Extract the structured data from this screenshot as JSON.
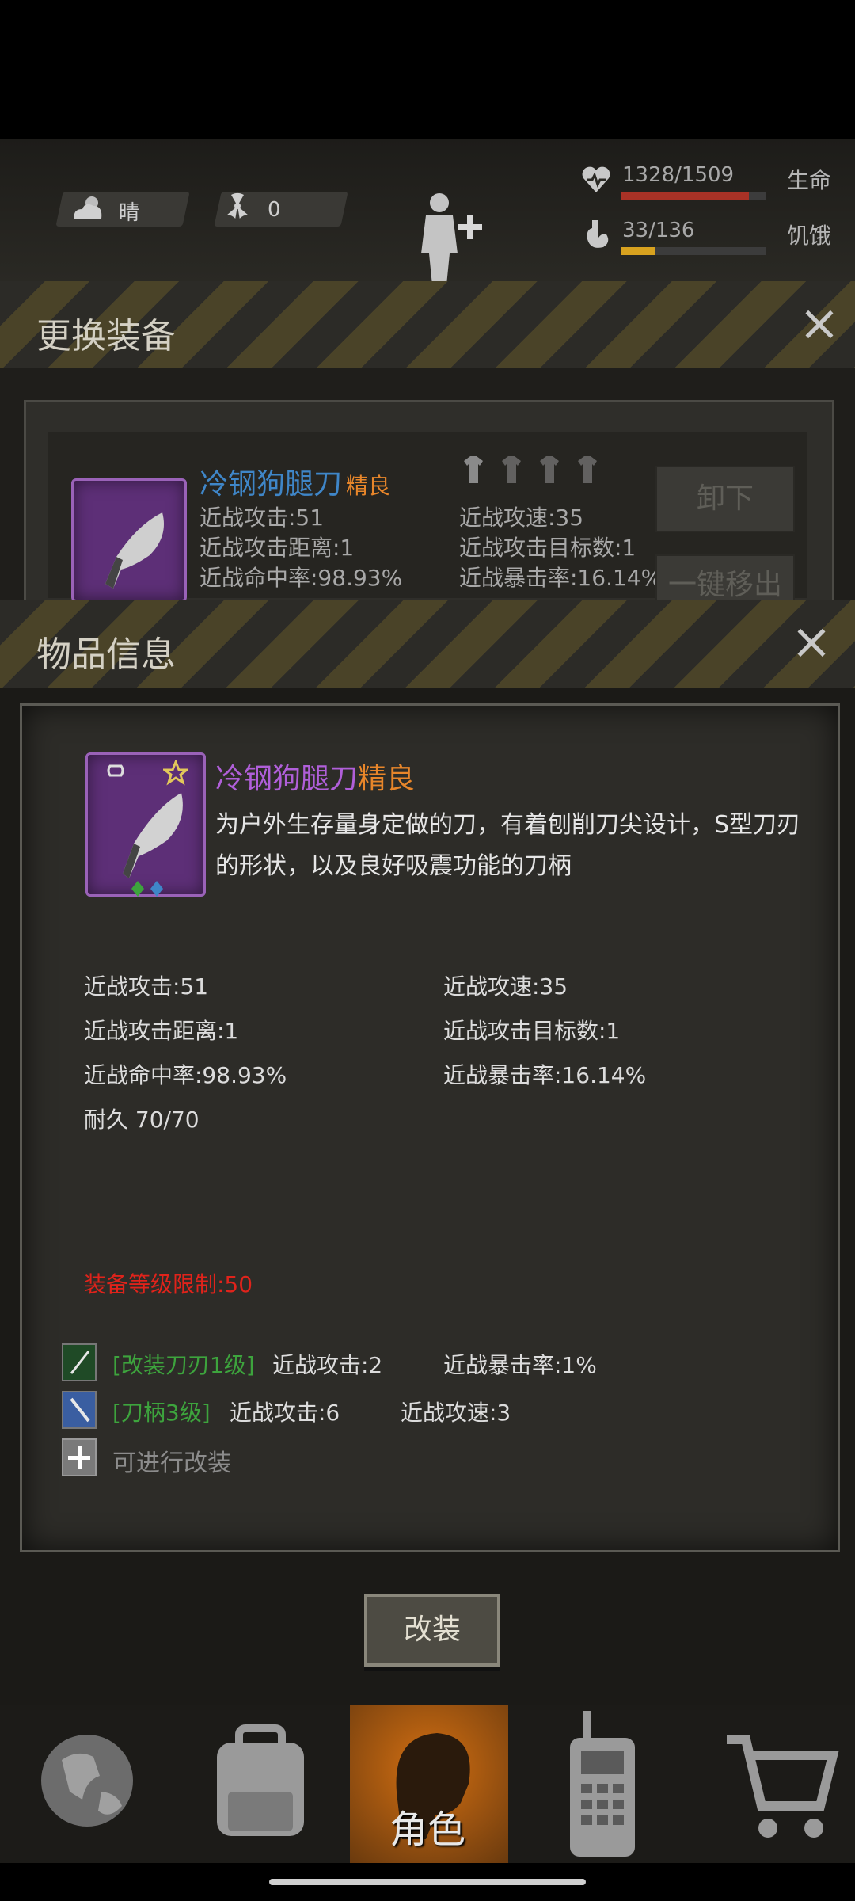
{
  "status_bar": {
    "weather_label": "晴",
    "radiation_value": "0",
    "health": {
      "text": "1328/1509",
      "label": "生命",
      "fraction": 0.88
    },
    "hunger": {
      "text": "33/136",
      "label": "饥饿",
      "fraction": 0.24
    }
  },
  "change_panel": {
    "title": "更换装备",
    "item_name": "冷钢狗腿刀",
    "item_quality": "精良",
    "stats_left": [
      "近战攻击:51",
      "近战攻击距离:1",
      "近战命中率:98.93%"
    ],
    "stats_right": [
      "近战攻速:35",
      "近战攻击目标数:1",
      "近战暴击率:16.14%"
    ],
    "unequip_label": "卸下",
    "remove_all_label": "一键移出"
  },
  "info_dialog": {
    "title": "物品信息",
    "item_name": "冷钢狗腿刀",
    "item_quality": "精良",
    "description_line1": "为户外生存量身定做的刀，有着刨削刀尖设计，S型刀刃",
    "description_line2": "的形状，以及良好吸震功能的刀柄",
    "stats_left": [
      "近战攻击:51",
      "近战攻击距离:1",
      "近战命中率:98.93%",
      "耐久 70/70"
    ],
    "stats_right": [
      "近战攻速:35",
      "近战攻击目标数:1",
      "近战暴击率:16.14%"
    ],
    "level_requirement": "装备等级限制:50",
    "mods": [
      {
        "name": "[改装刀刃1级]",
        "effect1": "近战攻击:2",
        "effect2": "近战暴击率:1%"
      },
      {
        "name": "[刀柄3级]",
        "effect1": "近战攻击:6",
        "effect2": "近战攻速:3"
      }
    ],
    "mod_available": "可进行改装",
    "modify_button": "改装"
  },
  "nav": {
    "role_label": "角色"
  },
  "colors": {
    "quality_orange": "#e8862a",
    "item_name_purple": "#b05fd9",
    "item_name_blue": "#3f86c8",
    "health_red": "#a83226",
    "hunger_yellow": "#d8a21f",
    "warning_red": "#e0231b",
    "mod_green": "#3da43d"
  },
  "icons": [
    "sun-cloud-icon",
    "radiation-icon",
    "human-plus-icon",
    "heart-icon",
    "stomach-icon",
    "link-icon",
    "star-icon",
    "globe-icon",
    "backpack-icon",
    "walkie-talkie-icon",
    "cart-icon"
  ]
}
